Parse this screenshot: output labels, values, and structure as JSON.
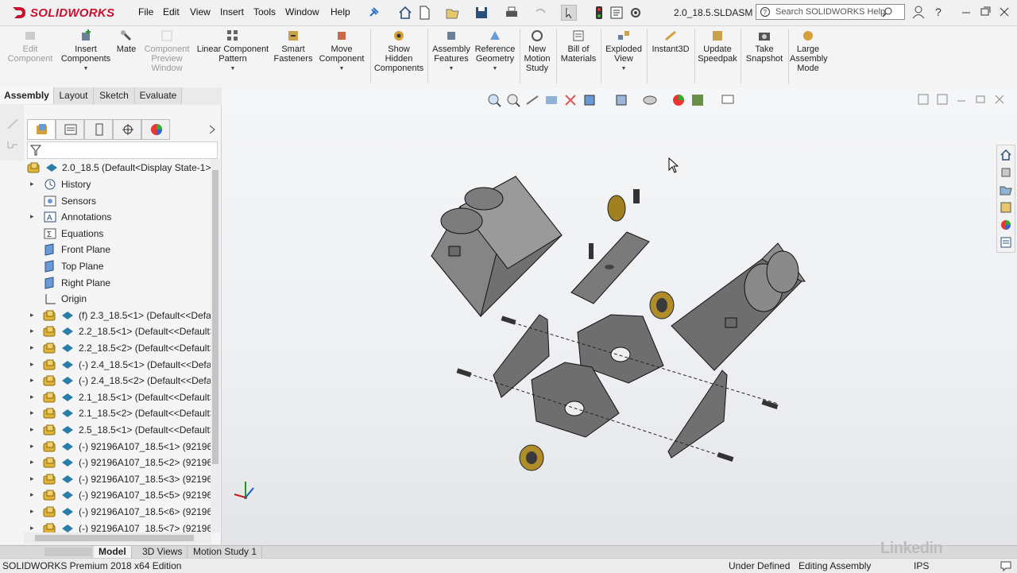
{
  "app": {
    "logo_text": "SOLIDWORKS",
    "brand_color": "#c8102e"
  },
  "menu": [
    "File",
    "Edit",
    "View",
    "Insert",
    "Tools",
    "Window",
    "Help"
  ],
  "document": {
    "filename": "2.0_18.5.SLDASM"
  },
  "search": {
    "placeholder": "Search SOLIDWORKS Help"
  },
  "command_manager": {
    "buttons": [
      {
        "label": "Edit Component",
        "lines": [
          "Edit",
          "Component"
        ],
        "disabled": true
      },
      {
        "label": "Insert Components",
        "lines": [
          "Insert",
          "Components"
        ],
        "disabled": false
      },
      {
        "label": "Mate",
        "lines": [
          "Mate"
        ],
        "disabled": false
      },
      {
        "label": "Component Preview Window",
        "lines": [
          "Component",
          "Preview",
          "Window"
        ],
        "disabled": true
      },
      {
        "label": "Linear Component Pattern",
        "lines": [
          "Linear Component",
          "Pattern"
        ],
        "disabled": false
      },
      {
        "label": "Smart Fasteners",
        "lines": [
          "Smart",
          "Fasteners"
        ],
        "disabled": false
      },
      {
        "label": "Move Component",
        "lines": [
          "Move",
          "Component"
        ],
        "disabled": false
      },
      {
        "label": "Show Hidden Components",
        "lines": [
          "Show",
          "Hidden",
          "Components"
        ],
        "disabled": false
      },
      {
        "label": "Assembly Features",
        "lines": [
          "Assembly",
          "Features"
        ],
        "disabled": false
      },
      {
        "label": "Reference Geometry",
        "lines": [
          "Reference",
          "Geometry"
        ],
        "disabled": false
      },
      {
        "label": "New Motion Study",
        "lines": [
          "New",
          "Motion",
          "Study"
        ],
        "disabled": false
      },
      {
        "label": "Bill of Materials",
        "lines": [
          "Bill of",
          "Materials"
        ],
        "disabled": false
      },
      {
        "label": "Exploded View",
        "lines": [
          "Exploded",
          "View"
        ],
        "disabled": false
      },
      {
        "label": "Instant3D",
        "lines": [
          "Instant3D"
        ],
        "disabled": false
      },
      {
        "label": "Update Speedpak",
        "lines": [
          "Update",
          "Speedpak"
        ],
        "disabled": false
      },
      {
        "label": "Take Snapshot",
        "lines": [
          "Take",
          "Snapshot"
        ],
        "disabled": false
      },
      {
        "label": "Large Assembly Mode",
        "lines": [
          "Large",
          "Assembly",
          "Mode"
        ],
        "disabled": false
      }
    ]
  },
  "tabs": [
    "Assembly",
    "Layout",
    "Sketch",
    "Evaluate"
  ],
  "tree": {
    "root": "2.0_18.5  (Default<Display State-1>)",
    "items": [
      {
        "label": "History",
        "expandable": true,
        "icon": "history-icon"
      },
      {
        "label": "Sensors",
        "expandable": false,
        "icon": "sensors-icon"
      },
      {
        "label": "Annotations",
        "expandable": true,
        "icon": "annotations-icon"
      },
      {
        "label": "Equations",
        "expandable": false,
        "icon": "equations-icon"
      },
      {
        "label": "Front Plane",
        "expandable": false,
        "icon": "plane-icon"
      },
      {
        "label": "Top Plane",
        "expandable": false,
        "icon": "plane-icon"
      },
      {
        "label": "Right Plane",
        "expandable": false,
        "icon": "plane-icon"
      },
      {
        "label": "Origin",
        "expandable": false,
        "icon": "origin-icon"
      },
      {
        "label": "(f) 2.3_18.5<1> (Default<<Defaul",
        "expandable": true,
        "icon": "component-icon"
      },
      {
        "label": "2.2_18.5<1> (Default<<Default>_",
        "expandable": true,
        "icon": "component-icon"
      },
      {
        "label": "2.2_18.5<2> (Default<<Default>_",
        "expandable": true,
        "icon": "component-icon"
      },
      {
        "label": "(-) 2.4_18.5<1> (Default<<Defaul",
        "expandable": true,
        "icon": "component-icon"
      },
      {
        "label": "(-) 2.4_18.5<2> (Default<<Defaul",
        "expandable": true,
        "icon": "component-icon"
      },
      {
        "label": "2.1_18.5<1> (Default<<Default>_",
        "expandable": true,
        "icon": "component-icon"
      },
      {
        "label": "2.1_18.5<2> (Default<<Default>_",
        "expandable": true,
        "icon": "component-icon"
      },
      {
        "label": "2.5_18.5<1> (Default<<Default>_",
        "expandable": true,
        "icon": "component-icon"
      },
      {
        "label": "(-) 92196A107_18.5<1> (92196A1(",
        "expandable": true,
        "icon": "component-icon"
      },
      {
        "label": "(-) 92196A107_18.5<2> (92196A1(",
        "expandable": true,
        "icon": "component-icon"
      },
      {
        "label": "(-) 92196A107_18.5<3> (92196A1(",
        "expandable": true,
        "icon": "component-icon"
      },
      {
        "label": "(-) 92196A107_18.5<5> (92196A1(",
        "expandable": true,
        "icon": "component-icon"
      },
      {
        "label": "(-) 92196A107_18.5<6> (92196A1(",
        "expandable": true,
        "icon": "component-icon"
      },
      {
        "label": "(-) 92196A107_18.5<7> (92196A1(",
        "expandable": true,
        "icon": "component-icon"
      }
    ]
  },
  "bottom_tabs": [
    "Model",
    "3D Views",
    "Motion Study 1"
  ],
  "status": {
    "edition": "SOLIDWORKS Premium 2018 x64 Edition",
    "state": "Under Defined",
    "mode": "Editing Assembly",
    "units": "IPS"
  },
  "watermark": "Linkedin"
}
